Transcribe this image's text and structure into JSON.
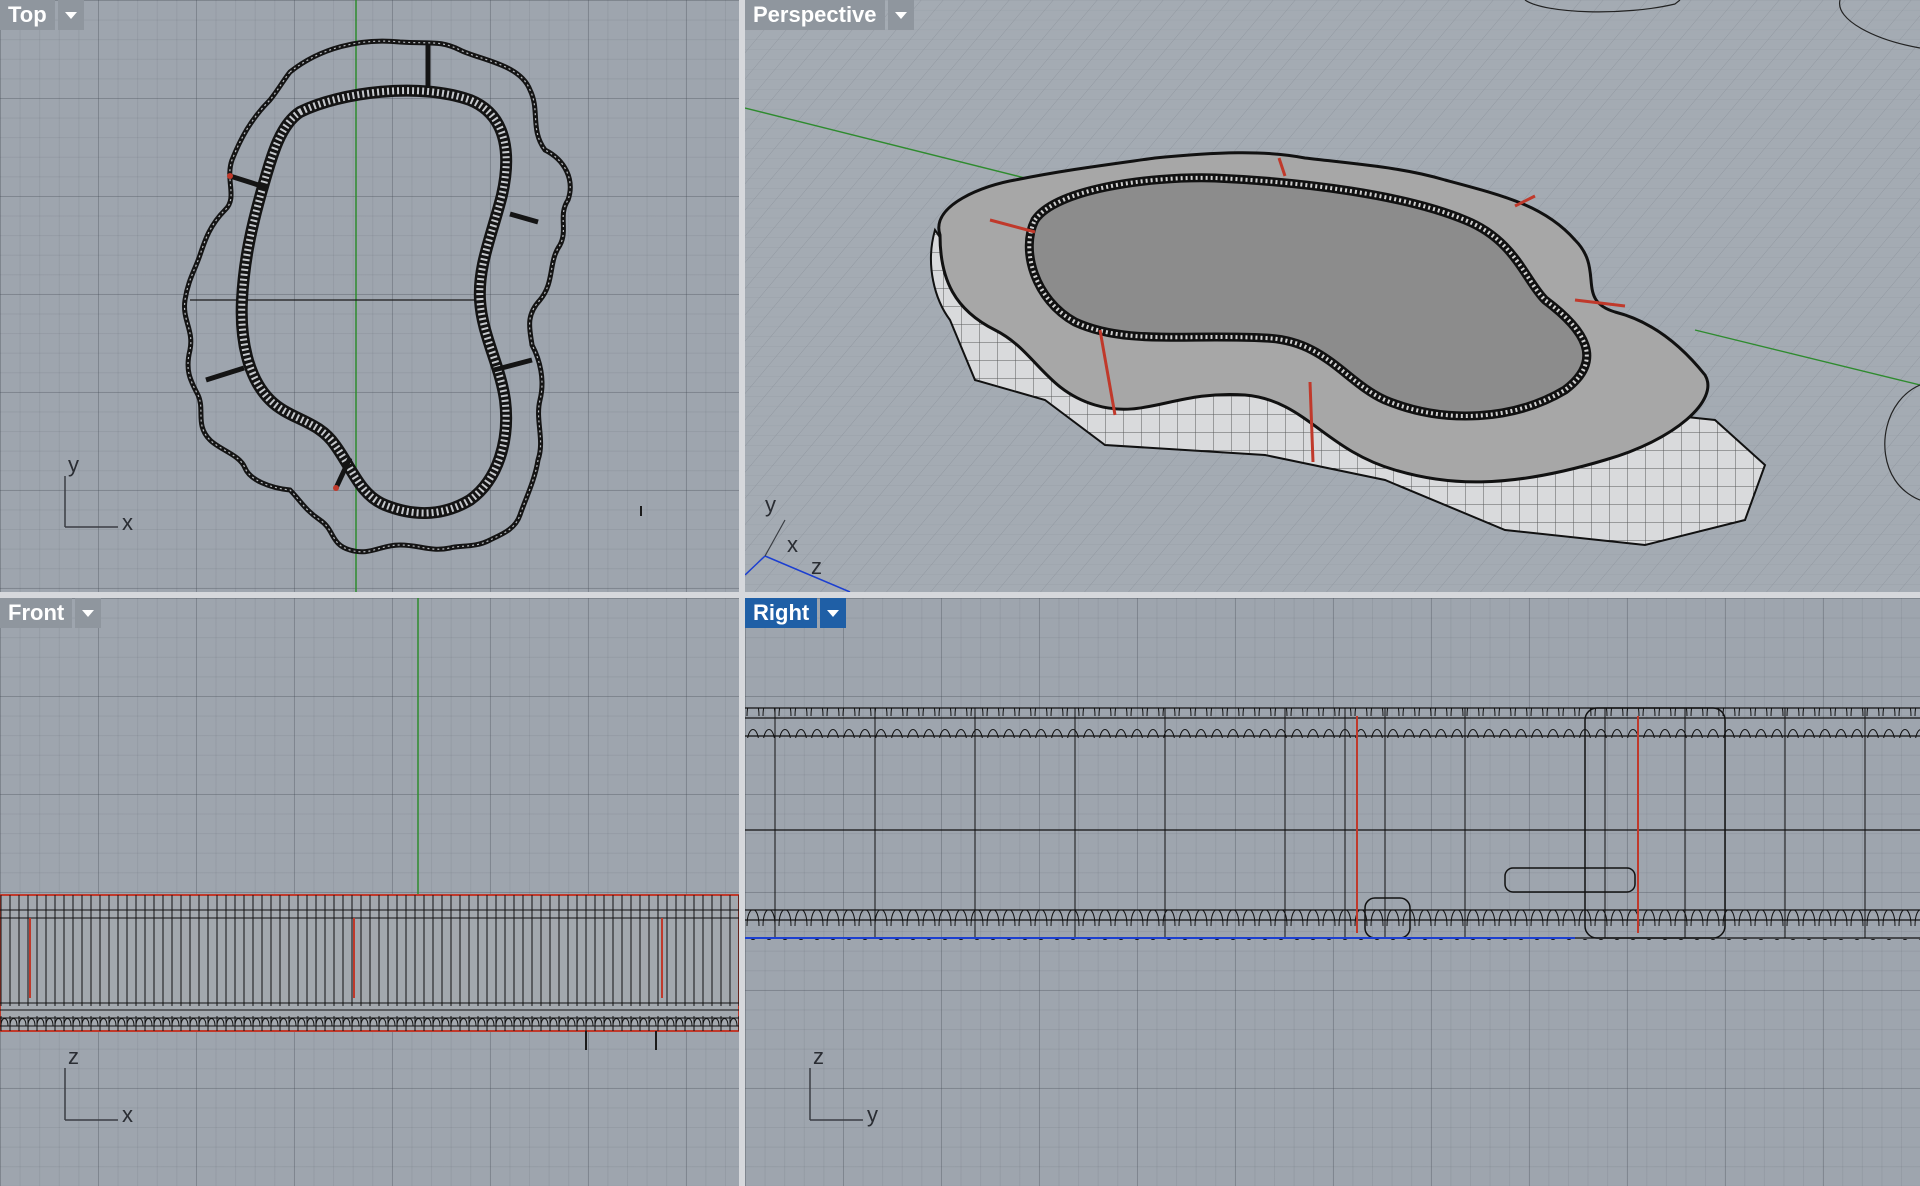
{
  "viewports": {
    "top": {
      "title": "Top",
      "axis_h": "x",
      "axis_v": "y",
      "active": false
    },
    "perspective": {
      "title": "Perspective",
      "axis_labels": [
        "y",
        "x",
        "z"
      ],
      "active": false
    },
    "front": {
      "title": "Front",
      "axis_h": "x",
      "axis_v": "z",
      "active": false
    },
    "right": {
      "title": "Right",
      "axis_h": "y",
      "axis_v": "z",
      "active": true
    }
  },
  "icons": {
    "viewport_menu": "chevron-down-icon"
  },
  "colors": {
    "viewport_bg": "#9ea5ae",
    "active_tab": "#1f5fa6",
    "inactive_tab": "#8f969e",
    "y_axis": "#2e8b2e",
    "x_axis_red": "#c0392b",
    "z_axis_blue": "#1c3fd1",
    "geometry_lines": "#111111",
    "surface_fill": "#8c8c8c"
  }
}
